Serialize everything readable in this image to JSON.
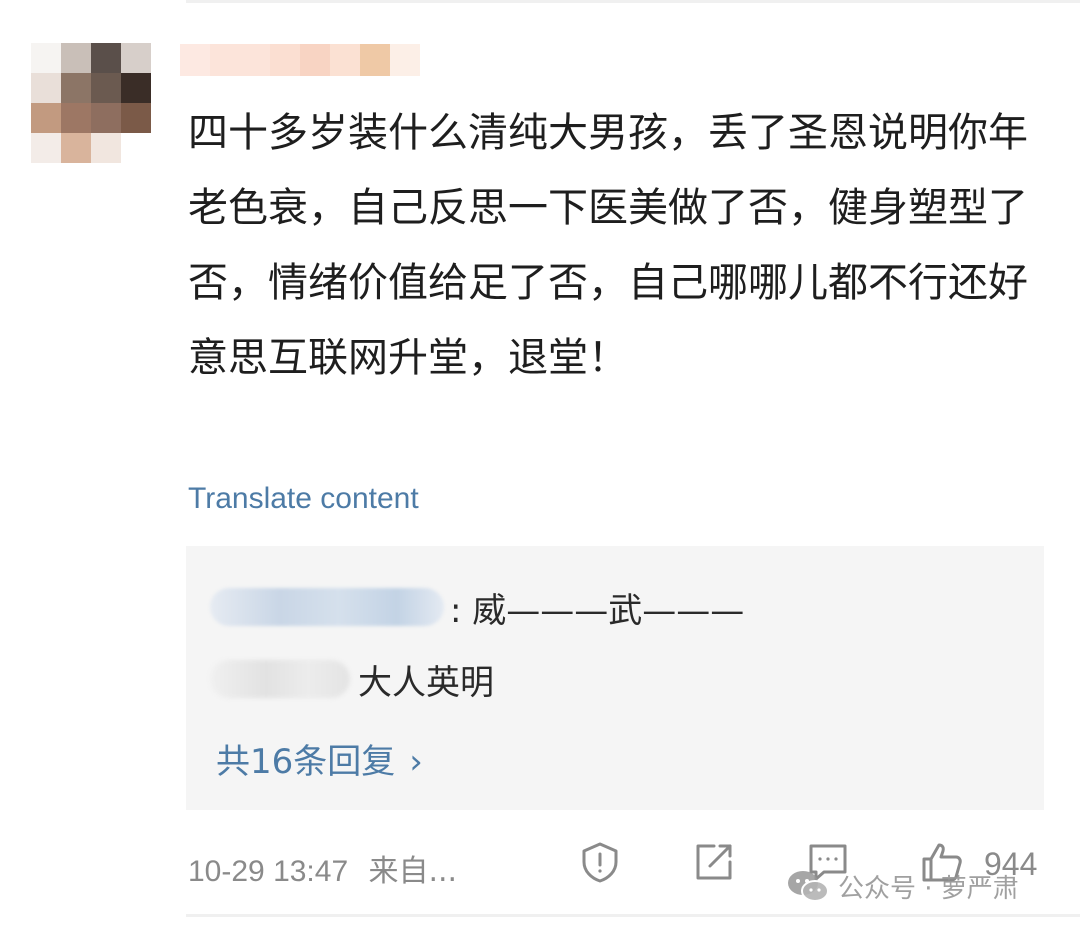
{
  "comment": {
    "text": "四十多岁装什么清纯大男孩，丢了圣恩说明你年老色衰，自己反思一下医美做了否，健身塑型了否，情绪价值给足了否，自己哪哪儿都不行还好意思互联网升堂，退堂！",
    "translate_label": "Translate content"
  },
  "replies": {
    "items": [
      {
        "text": ": 威———武———"
      },
      {
        "text": "大人英明"
      }
    ],
    "more_label": "共16条回复",
    "more_chevron": "›"
  },
  "meta": {
    "timestamp": "10-29 13:47",
    "source": "来自..."
  },
  "actions": {
    "like_count": "944",
    "icons": [
      "report-icon",
      "share-icon",
      "comment-icon",
      "like-icon"
    ]
  },
  "watermark": {
    "text": "公众号 · 萝严肃"
  },
  "colors": {
    "link": "#4d7ba6",
    "meta_text": "#8a8a8a",
    "reply_bg": "#f5f5f5"
  }
}
